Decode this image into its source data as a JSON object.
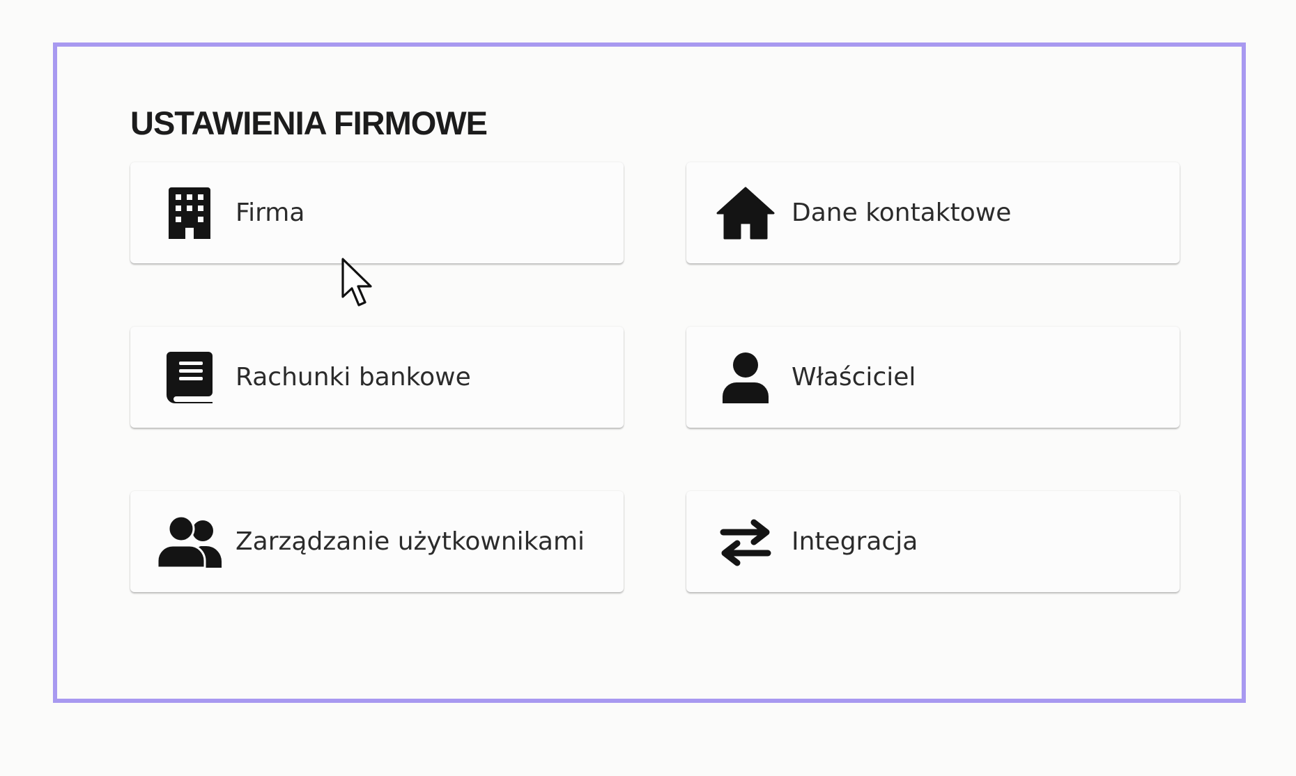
{
  "section": {
    "title": "USTAWIENIA FIRMOWE"
  },
  "cards": [
    {
      "label": "Firma",
      "icon": "building-icon"
    },
    {
      "label": "Dane kontaktowe",
      "icon": "home-icon"
    },
    {
      "label": "Rachunki bankowe",
      "icon": "book-icon"
    },
    {
      "label": "Właściciel",
      "icon": "person-icon"
    },
    {
      "label": "Zarządzanie użytkownikami",
      "icon": "users-icon"
    },
    {
      "label": "Integracja",
      "icon": "swap-arrows-icon"
    }
  ],
  "colors": {
    "frame_border": "#a899f0",
    "icon": "#141414",
    "text": "#2b2b2b"
  }
}
